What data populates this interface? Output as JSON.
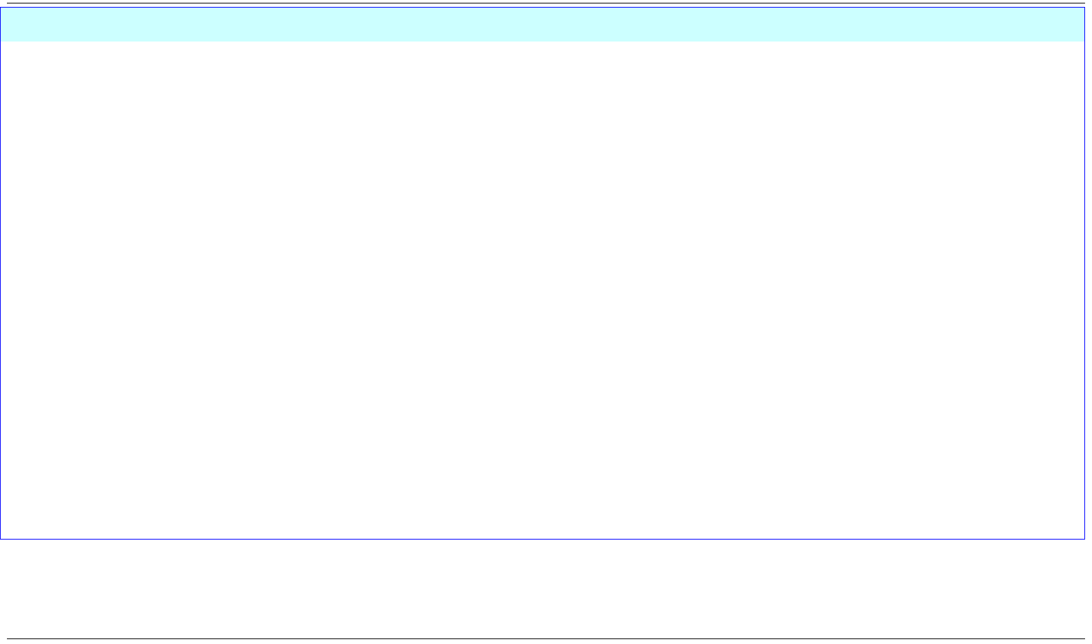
{
  "colors": {
    "frame_border": "#0000ff",
    "header_background": "#ccffff",
    "body_background": "#ffffff",
    "rule_color": "#000000"
  }
}
